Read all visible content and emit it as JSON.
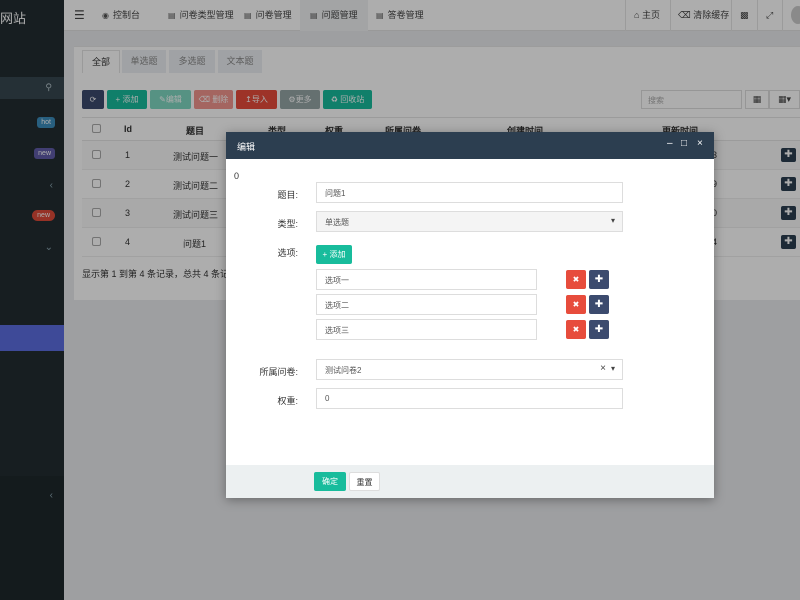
{
  "sidebar": {
    "brand": "网站",
    "badges": [
      "hot",
      "new",
      "new"
    ]
  },
  "topnav": {
    "tabs": [
      {
        "label": "控制台",
        "icon": "dashboard-icon"
      },
      {
        "label": "问卷类型管理",
        "icon": "list-icon"
      },
      {
        "label": "问卷管理",
        "icon": "list-icon"
      },
      {
        "label": "问题管理",
        "icon": "list-icon"
      },
      {
        "label": "答卷管理",
        "icon": "list-icon"
      }
    ],
    "right": {
      "home": "主页",
      "clear_cache": "清除缓存"
    }
  },
  "filter_tabs": [
    "全部",
    "单选题",
    "多选题",
    "文本题"
  ],
  "toolbar": {
    "add": "添加",
    "edit": "编辑",
    "delete": "删除",
    "import": "导入",
    "more": "更多",
    "recycle": "回收站",
    "search_placeholder": "搜索"
  },
  "table": {
    "headers": [
      "Id",
      "题目",
      "类型",
      "权重",
      "所属问卷",
      "创建时间",
      "更新时间"
    ],
    "rows": [
      {
        "id": "1",
        "title": "测试问题一",
        "updated_tail": "3"
      },
      {
        "id": "2",
        "title": "测试问题二",
        "updated_tail": "9"
      },
      {
        "id": "3",
        "title": "测试问题三",
        "updated_tail": "0"
      },
      {
        "id": "4",
        "title": "问题1",
        "updated_tail": "4"
      }
    ],
    "pagination": "显示第 1 到第 4 条记录，总共 4 条记录"
  },
  "modal": {
    "title": "编辑",
    "stray_value": "0",
    "labels": {
      "title": "题目:",
      "type": "类型:",
      "options": "选项:",
      "questionnaire": "所属问卷:",
      "weight": "权重:"
    },
    "title_value": "问题1",
    "type_value": "单选题",
    "add_option": "添加",
    "options": [
      "选项一",
      "选项二",
      "选项三"
    ],
    "questionnaire_value": "测试问卷2",
    "weight_value": "0",
    "confirm": "确定",
    "reset": "重置"
  },
  "colors": {
    "sidebar_bg": "#222d32",
    "header_bg": "#2c3e50",
    "primary_green": "#18bc9c",
    "danger_red": "#e74c3c",
    "navy": "#3c4b6e"
  }
}
